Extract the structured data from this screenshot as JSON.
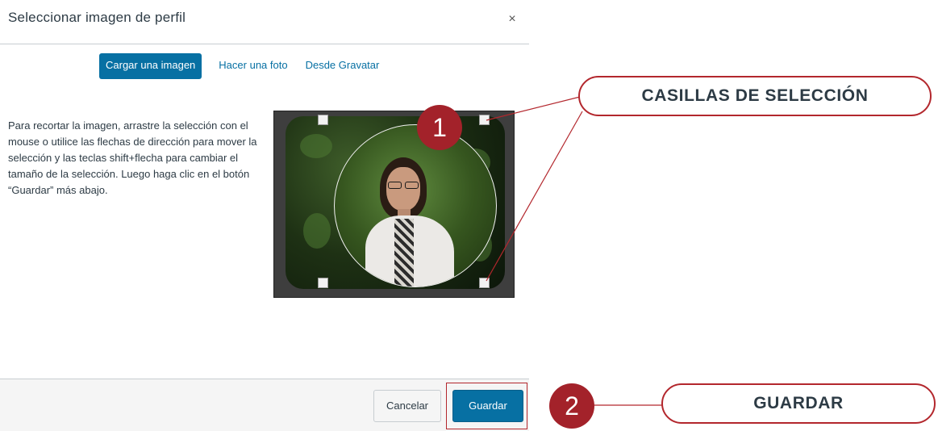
{
  "dialog": {
    "title": "Seleccionar imagen de perfil",
    "close_glyph": "×",
    "tabs": [
      {
        "label": "Cargar una imagen",
        "active": true
      },
      {
        "label": "Hacer una foto",
        "active": false
      },
      {
        "label": "Desde Gravatar",
        "active": false
      }
    ],
    "instructions": "Para recortar la imagen, arrastre la selección con el mouse o utilice las flechas de dirección para mover la selección y las teclas shift+flecha para cambiar el tamaño de la selección. Luego haga clic en el botón “Guardar” más abajo.",
    "footer": {
      "cancel_label": "Cancelar",
      "save_label": "Guardar"
    }
  },
  "annotations": {
    "badge_1": "1",
    "callout_1": "CASILLAS DE SELECCIÓN",
    "badge_2": "2",
    "callout_2": "GUARDAR"
  },
  "colors": {
    "primary": "#0770a3",
    "annotation_red": "#a3222a"
  }
}
